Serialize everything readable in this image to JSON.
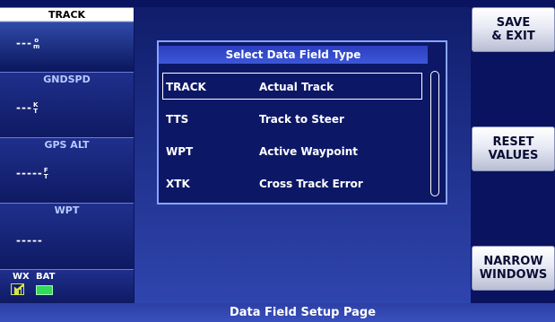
{
  "sidebar": {
    "fields": [
      {
        "label": "TRACK",
        "value": "---",
        "unit_top": "o",
        "unit_bottom": "m",
        "selected": true
      },
      {
        "label": "GNDSPD",
        "value": "---",
        "unit_top": "K",
        "unit_bottom": "T",
        "selected": false
      },
      {
        "label": "GPS ALT",
        "value": "-----",
        "unit_top": "F",
        "unit_bottom": "T",
        "selected": false
      },
      {
        "label": "WPT",
        "value": "-----",
        "unit_top": "",
        "unit_bottom": "",
        "selected": false
      }
    ],
    "status": {
      "wx_label": "WX",
      "bat_label": "BAT",
      "wx_icon": "signal-bars-icon",
      "bat_icon": "battery-icon"
    }
  },
  "dialog": {
    "title": "Select Data Field Type",
    "options": [
      {
        "code": "TRACK",
        "desc": "Actual Track",
        "selected": true
      },
      {
        "code": "TTS",
        "desc": "Track to Steer",
        "selected": false
      },
      {
        "code": "WPT",
        "desc": "Active Waypoint",
        "selected": false
      },
      {
        "code": "XTK",
        "desc": "Cross Track Error",
        "selected": false
      }
    ]
  },
  "buttons": {
    "save_exit": "SAVE\n& EXIT",
    "reset_values": "RESET\nVALUES",
    "narrow_windows": "NARROW\nWINDOWS"
  },
  "page_title": "Data Field Setup Page",
  "colors": {
    "background": "#0a1360",
    "dialog_border": "#8aa4ff",
    "accent": "#3d57d8",
    "battery": "#33d95a"
  }
}
